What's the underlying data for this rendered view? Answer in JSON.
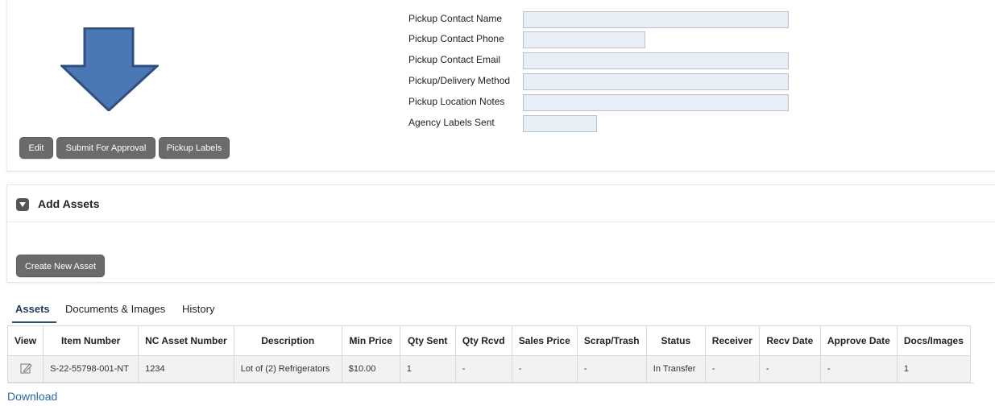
{
  "top_panel": {
    "buttons": {
      "edit": "Edit",
      "submit": "Submit For Approval",
      "pickup_labels": "Pickup Labels"
    },
    "form": [
      {
        "label": "Pickup Contact Name",
        "value": ""
      },
      {
        "label": "Pickup Contact Phone",
        "value": ""
      },
      {
        "label": "Pickup Contact Email",
        "value": ""
      },
      {
        "label": "Pickup/Delivery Method",
        "value": ""
      },
      {
        "label": "Pickup Location Notes",
        "value": ""
      },
      {
        "label": "Agency Labels Sent",
        "value": ""
      }
    ],
    "arrow_color": "#4a78b5"
  },
  "add_assets": {
    "title": "Add Assets",
    "create_button": "Create New Asset"
  },
  "tabs": [
    {
      "label": "Assets",
      "active": true
    },
    {
      "label": "Documents & Images",
      "active": false
    },
    {
      "label": "History",
      "active": false
    }
  ],
  "table": {
    "headers": [
      "View",
      "Item Number",
      "NC Asset Number",
      "Description",
      "Min Price",
      "Qty Sent",
      "Qty Rcvd",
      "Sales Price",
      "Scrap/Trash",
      "Status",
      "Receiver",
      "Recv Date",
      "Approve Date",
      "Docs/Images"
    ],
    "rows": [
      {
        "view_icon": "edit-icon",
        "item_number": "S-22-55798-001-NT",
        "nc_asset_number": "1234",
        "description": "Lot of (2) Refrigerators",
        "min_price": "$10.00",
        "qty_sent": "1",
        "qty_rcvd": "-",
        "sales_price": "-",
        "scrap_trash": "-",
        "status": "In Transfer",
        "receiver": "-",
        "recv_date": "-",
        "approve_date": "-",
        "docs_images": "1"
      }
    ]
  },
  "download_link": "Download"
}
